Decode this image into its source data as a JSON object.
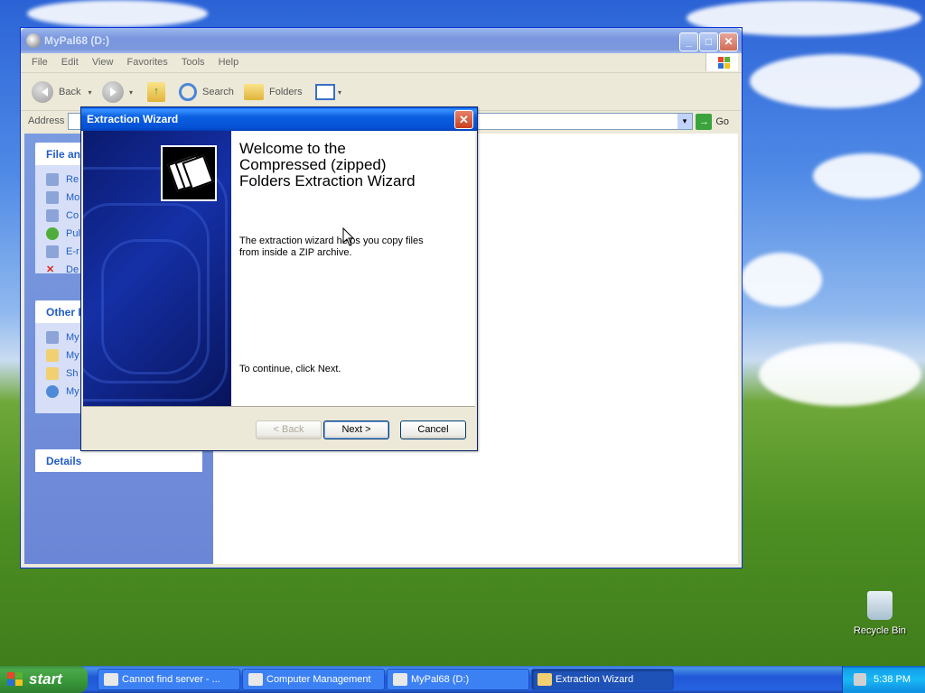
{
  "explorer": {
    "title": "MyPal68 (D:)",
    "menus": [
      "File",
      "Edit",
      "View",
      "Favorites",
      "Tools",
      "Help"
    ],
    "toolbar": {
      "back": "Back",
      "search": "Search",
      "folders": "Folders"
    },
    "address_label": "Address",
    "go_label": "Go",
    "tasks_header": "File an",
    "task_links": [
      "Re",
      "Mo",
      "Co",
      "Pul",
      "E-r",
      "De"
    ],
    "other_header": "Other I",
    "other_links": [
      "My",
      "My",
      "Sh",
      "My"
    ],
    "details_header": "Details"
  },
  "dialog": {
    "title": "Extraction Wizard",
    "heading": "Welcome to the Compressed (zipped) Folders Extraction Wizard",
    "description": "The extraction wizard helps you copy files from inside a ZIP archive.",
    "continue_text": "To continue, click Next.",
    "back_label": "< Back",
    "next_label": "Next >",
    "cancel_label": "Cancel"
  },
  "desktop": {
    "recycle_bin": "Recycle Bin"
  },
  "taskbar": {
    "start_label": "start",
    "tasks": [
      "Cannot find server - ...",
      "Computer Management",
      "MyPal68 (D:)",
      "Extraction Wizard"
    ],
    "active_task": "Extraction Wizard",
    "clock": "5:38 PM"
  }
}
